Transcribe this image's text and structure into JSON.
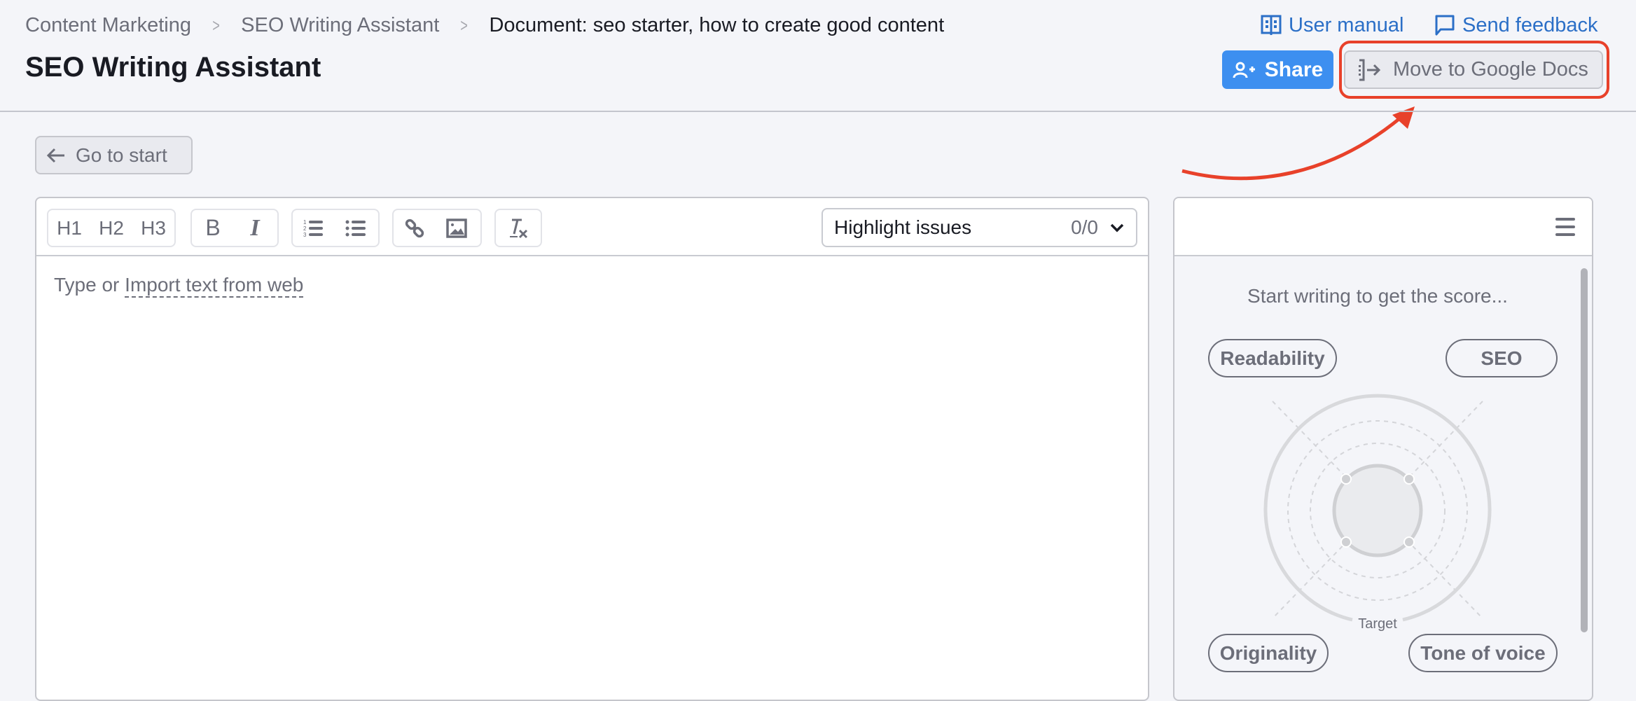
{
  "header": {
    "breadcrumb": [
      "Content Marketing",
      "SEO Writing Assistant",
      "Document: seo starter, how to create good content"
    ],
    "title": "SEO Writing Assistant",
    "links": {
      "user_manual": "User manual",
      "send_feedback": "Send feedback"
    },
    "share_label": "Share",
    "google_docs_label": "Move to Google Docs"
  },
  "go_to_start_label": "Go to start",
  "editor": {
    "toolbar": {
      "headings": [
        "H1",
        "H2",
        "H3"
      ],
      "format": [
        "B",
        "I"
      ],
      "highlight_label": "Highlight issues",
      "highlight_count": "0/0"
    },
    "placeholder_prefix": "Type or",
    "import_link": "Import text from web"
  },
  "score_panel": {
    "hint": "Start writing to get the score...",
    "categories": [
      "Readability",
      "SEO",
      "Originality",
      "Tone of voice"
    ],
    "target_label": "Target"
  },
  "colors": {
    "accent": "#3d8ff0",
    "link": "#2b6fc7",
    "annotation": "#e8412a"
  }
}
